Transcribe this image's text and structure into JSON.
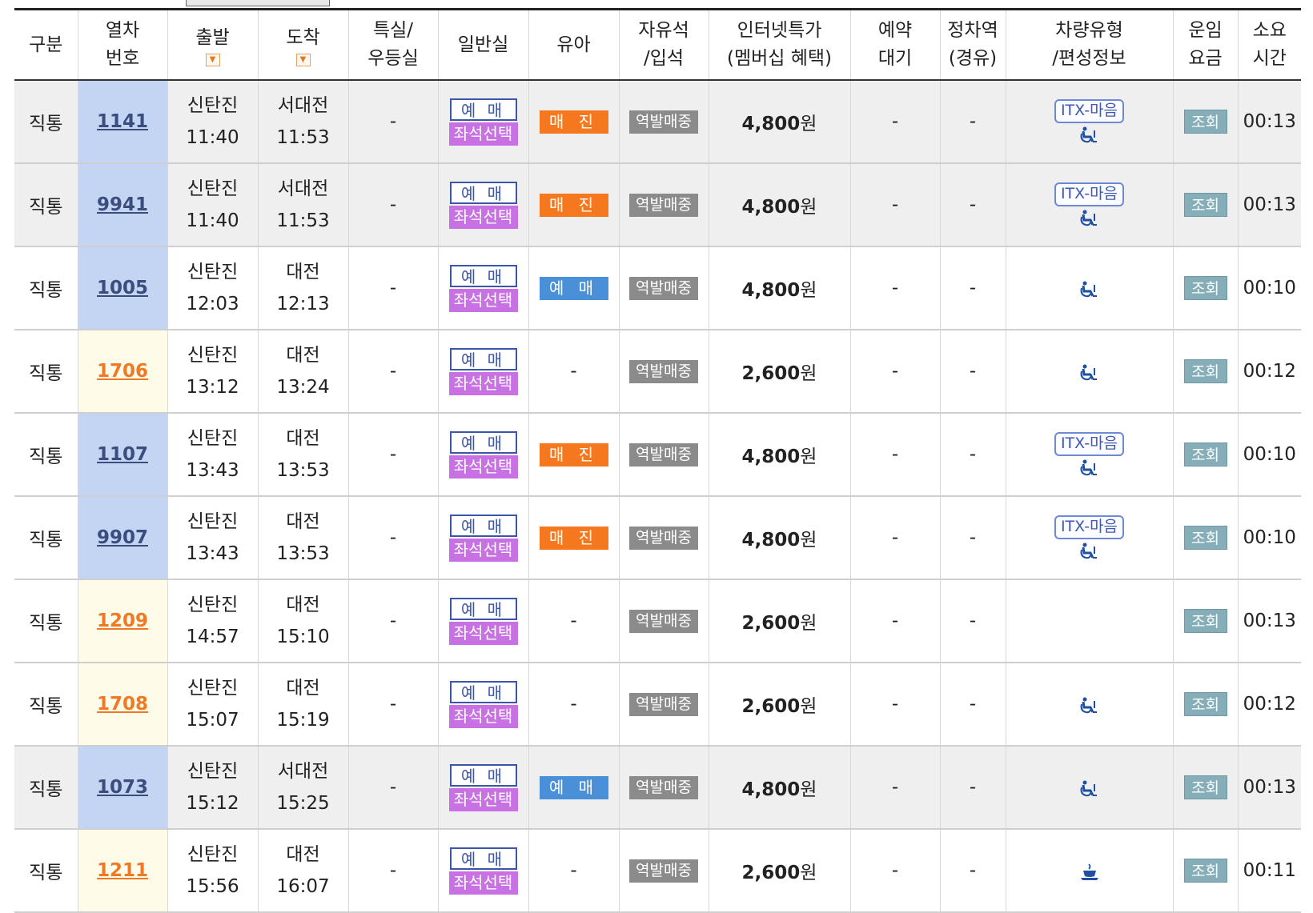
{
  "headers": [
    "구분",
    "열차|번호",
    "출발",
    "도착",
    "특실/|우등실",
    "일반실",
    "유아",
    "자유석|/입석",
    "인터넷특가|(멤버십 혜택)",
    "예약|대기",
    "정차역|(경유)",
    "차량유형|/편성정보",
    "운임|요금",
    "소요|시간"
  ],
  "sort_icon": "sort-down-icon",
  "labels": {
    "book": "예 매",
    "seat_select": "좌석선택",
    "sold_out": "매 진",
    "reserve": "예 매",
    "station_sale": "역발매중",
    "view": "조회",
    "dash": "-",
    "itx": "ITX-마음"
  },
  "colors": {
    "blue_row": "#c4d5f4",
    "cream_row": "#fffbe9",
    "orange": "#f5781f",
    "purple": "#c871e2"
  },
  "rows": [
    {
      "type": "직통",
      "train": "1141",
      "tcolor": "blue",
      "gray": true,
      "dep": "신탄진",
      "dep_time": "11:40",
      "arr": "서대전",
      "arr_time": "11:53",
      "special": "-",
      "infant": "sold_out",
      "price": "4,800",
      "won": "원",
      "waitlist": "-",
      "stops": "-",
      "itx": true,
      "vehicle": "wheelchair-icon",
      "duration": "00:13"
    },
    {
      "type": "직통",
      "train": "9941",
      "tcolor": "blue",
      "gray": true,
      "dep": "신탄진",
      "dep_time": "11:40",
      "arr": "서대전",
      "arr_time": "11:53",
      "special": "-",
      "infant": "sold_out",
      "price": "4,800",
      "won": "원",
      "waitlist": "-",
      "stops": "-",
      "itx": true,
      "vehicle": "wheelchair-icon",
      "duration": "00:13"
    },
    {
      "type": "직통",
      "train": "1005",
      "tcolor": "blue",
      "gray": false,
      "dep": "신탄진",
      "dep_time": "12:03",
      "arr": "대전",
      "arr_time": "12:13",
      "special": "-",
      "infant": "reserve",
      "price": "4,800",
      "won": "원",
      "waitlist": "-",
      "stops": "-",
      "itx": false,
      "vehicle": "wheelchair-icon",
      "duration": "00:10"
    },
    {
      "type": "직통",
      "train": "1706",
      "tcolor": "orange",
      "gray": false,
      "dep": "신탄진",
      "dep_time": "13:12",
      "arr": "대전",
      "arr_time": "13:24",
      "special": "-",
      "infant": "-",
      "price": "2,600",
      "won": "원",
      "waitlist": "-",
      "stops": "-",
      "itx": false,
      "vehicle": "wheelchair-icon",
      "duration": "00:12"
    },
    {
      "type": "직통",
      "train": "1107",
      "tcolor": "blue",
      "gray": false,
      "dep": "신탄진",
      "dep_time": "13:43",
      "arr": "대전",
      "arr_time": "13:53",
      "special": "-",
      "infant": "sold_out",
      "price": "4,800",
      "won": "원",
      "waitlist": "-",
      "stops": "-",
      "itx": true,
      "vehicle": "wheelchair-icon",
      "duration": "00:10"
    },
    {
      "type": "직통",
      "train": "9907",
      "tcolor": "blue",
      "gray": false,
      "dep": "신탄진",
      "dep_time": "13:43",
      "arr": "대전",
      "arr_time": "13:53",
      "special": "-",
      "infant": "sold_out",
      "price": "4,800",
      "won": "원",
      "waitlist": "-",
      "stops": "-",
      "itx": true,
      "vehicle": "wheelchair-icon",
      "duration": "00:10"
    },
    {
      "type": "직통",
      "train": "1209",
      "tcolor": "orange",
      "gray": false,
      "dep": "신탄진",
      "dep_time": "14:57",
      "arr": "대전",
      "arr_time": "15:10",
      "special": "-",
      "infant": "-",
      "price": "2,600",
      "won": "원",
      "waitlist": "-",
      "stops": "-",
      "itx": false,
      "vehicle": "",
      "duration": "00:13"
    },
    {
      "type": "직통",
      "train": "1708",
      "tcolor": "orange",
      "gray": false,
      "dep": "신탄진",
      "dep_time": "15:07",
      "arr": "대전",
      "arr_time": "15:19",
      "special": "-",
      "infant": "-",
      "price": "2,600",
      "won": "원",
      "waitlist": "-",
      "stops": "-",
      "itx": false,
      "vehicle": "wheelchair-icon",
      "duration": "00:12"
    },
    {
      "type": "직통",
      "train": "1073",
      "tcolor": "blue",
      "gray": true,
      "dep": "신탄진",
      "dep_time": "15:12",
      "arr": "서대전",
      "arr_time": "15:25",
      "special": "-",
      "infant": "reserve",
      "price": "4,800",
      "won": "원",
      "waitlist": "-",
      "stops": "-",
      "itx": false,
      "vehicle": "wheelchair-icon",
      "duration": "00:13"
    },
    {
      "type": "직통",
      "train": "1211",
      "tcolor": "orange",
      "gray": false,
      "dep": "신탄진",
      "dep_time": "15:56",
      "arr": "대전",
      "arr_time": "16:07",
      "special": "-",
      "infant": "-",
      "price": "2,600",
      "won": "원",
      "waitlist": "-",
      "stops": "-",
      "itx": false,
      "vehicle": "cafe-cup-icon",
      "duration": "00:11"
    }
  ]
}
